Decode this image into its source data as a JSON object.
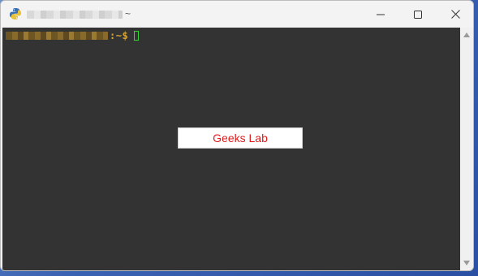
{
  "window": {
    "title": "~",
    "buttons": {
      "minimize": "minimize",
      "maximize": "maximize",
      "close": "close"
    }
  },
  "terminal": {
    "prompt_suffix": ":~$",
    "background": "#333333",
    "prompt_color": "#d8a530",
    "cursor_color": "#33d633"
  },
  "dialog": {
    "text": "Geeks Lab",
    "text_color": "#e01b1b"
  },
  "icons": [
    "python-app-icon",
    "minimize-icon",
    "maximize-icon",
    "close-icon",
    "scroll-up-icon",
    "scroll-down-icon"
  ]
}
